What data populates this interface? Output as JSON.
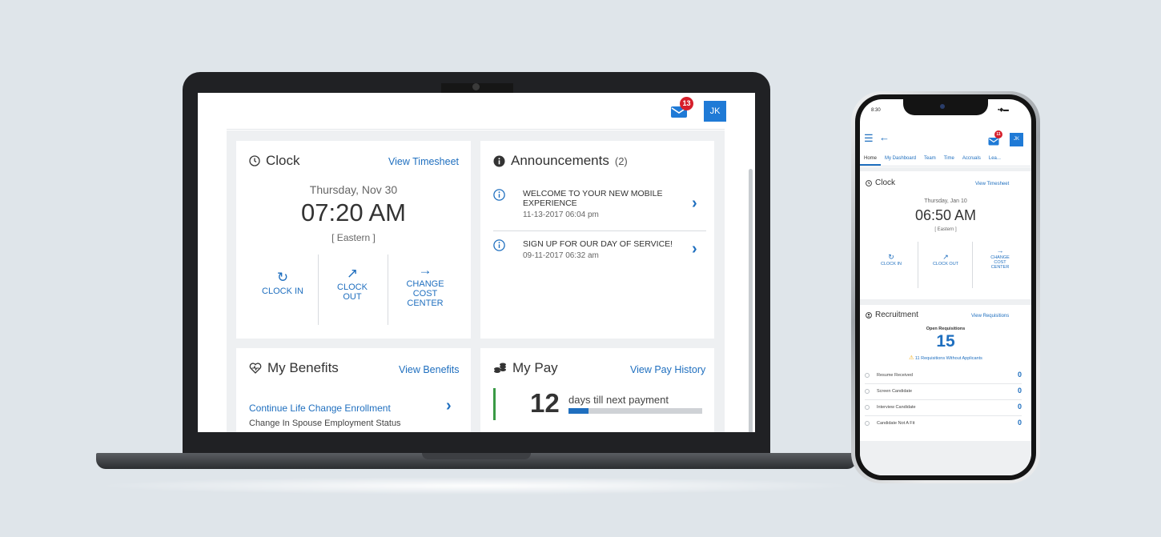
{
  "laptop": {
    "header": {
      "mail_badge": "13",
      "avatar_initials": "JK"
    },
    "clock": {
      "title": "Clock",
      "link": "View Timesheet",
      "date": "Thursday, Nov 30",
      "time": "07:20 AM",
      "timezone": "[ Eastern ]",
      "actions": [
        {
          "label": "CLOCK IN",
          "icon": "clock-in-icon"
        },
        {
          "label": "CLOCK OUT",
          "icon": "clock-out-icon"
        },
        {
          "label": "CHANGE COST CENTER",
          "icon": "arrow-right-icon"
        }
      ]
    },
    "announcements": {
      "title": "Announcements",
      "count": "(2)",
      "items": [
        {
          "title": "WELCOME TO YOUR NEW MOBILE EXPERIENCE",
          "date": "11-13-2017 06:04 pm"
        },
        {
          "title": "SIGN UP FOR OUR DAY OF SERVICE!",
          "date": "09-11-2017 06:32 am"
        }
      ]
    },
    "benefits": {
      "title": "My Benefits",
      "link": "View Benefits",
      "item_title": "Continue Life Change Enrollment",
      "item_subtitle": "Change In Spouse Employment Status"
    },
    "pay": {
      "title": "My Pay",
      "link": "View Pay History",
      "days": "12",
      "days_label": "days till next payment",
      "progress_fraction": 0.15
    }
  },
  "phone": {
    "status_time": "8:30",
    "mail_badge": "11",
    "avatar_initials": "JK",
    "tabs": [
      "Home",
      "My Dashboard",
      "Team",
      "Time",
      "Accruals",
      "Lea..."
    ],
    "clock": {
      "title": "Clock",
      "link": "View Timesheet",
      "date": "Thursday, Jan 10",
      "time": "06:50 AM",
      "timezone": "[ Eastern ]",
      "actions": [
        {
          "label": "CLOCK IN"
        },
        {
          "label": "CLOCK OUT"
        },
        {
          "label": "CHANGE COST CENTER"
        }
      ]
    },
    "recruitment": {
      "title": "Recruitment",
      "link": "View Requisitions",
      "open_label": "Open Requisitions",
      "open_count": "15",
      "warning": "11 Requisitions Without Applicants",
      "rows": [
        {
          "label": "Resume Received",
          "value": "0"
        },
        {
          "label": "Screen Candidate",
          "value": "0"
        },
        {
          "label": "Interview Candidate",
          "value": "0"
        },
        {
          "label": "Candidate Not A Fit",
          "value": "0"
        }
      ]
    }
  },
  "colors": {
    "accent": "#1f6fbf",
    "badge": "#d61f2b",
    "pay_bar": "#3a9a45",
    "background": "#dfe5ea"
  }
}
